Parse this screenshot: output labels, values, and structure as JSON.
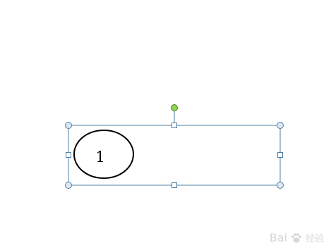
{
  "canvas": {
    "background": "#ffffff"
  },
  "selection": {
    "border_color": "#4f7fa0",
    "corner_handle_fill": "#dbe8f5",
    "edge_handle_fill": "#ffffff",
    "rotate_handle_fill": "#8ed34f",
    "rotate_handle_stroke": "#4f7f2b"
  },
  "ellipse": {
    "label": "1",
    "stroke": "#000000"
  },
  "watermark": {
    "brand": "Bai",
    "brand_end": "经验",
    "icon": "paw-icon",
    "color": "#d7d7d7"
  }
}
